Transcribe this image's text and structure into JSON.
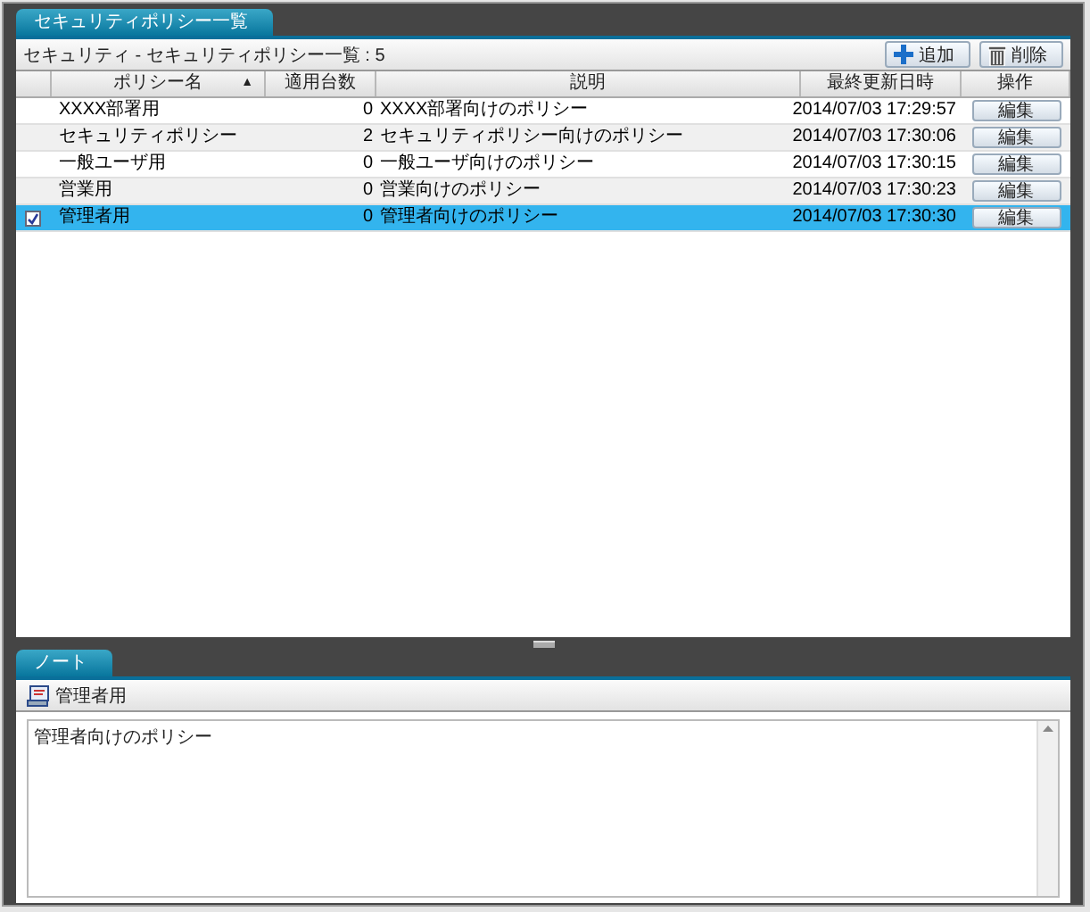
{
  "list_tab": {
    "label": "セキュリティポリシー一覧",
    "selected": true
  },
  "list_header": {
    "title": "セキュリティ - セキュリティポリシー一覧 : 5",
    "buttons": [
      {
        "kind": "add",
        "label": "追加"
      },
      {
        "kind": "delete",
        "label": "削除"
      }
    ]
  },
  "table": {
    "columns": [
      {
        "label": "ポリシー名",
        "sort": "▲"
      },
      {
        "label": "適用台数"
      },
      {
        "label": "説明"
      },
      {
        "label": "最終更新日時"
      },
      {
        "label": "操作"
      }
    ],
    "rows": [
      {
        "checked": false,
        "selected": false,
        "name": "XXXX部署用",
        "count": "0",
        "description": "XXXX部署向けのポリシー",
        "updated": "2014/07/03 17:29:57",
        "action": "編集"
      },
      {
        "checked": false,
        "selected": false,
        "name": "セキュリティポリシー",
        "count": "2",
        "description": "セキュリティポリシー向けのポリシー",
        "updated": "2014/07/03 17:30:06",
        "action": "編集"
      },
      {
        "checked": false,
        "selected": false,
        "name": "一般ユーザ用",
        "count": "0",
        "description": "一般ユーザ向けのポリシー",
        "updated": "2014/07/03 17:30:15",
        "action": "編集"
      },
      {
        "checked": false,
        "selected": false,
        "name": "営業用",
        "count": "0",
        "description": "営業向けのポリシー",
        "updated": "2014/07/03 17:30:23",
        "action": "編集"
      },
      {
        "checked": true,
        "selected": true,
        "name": "管理者用",
        "count": "0",
        "description": "管理者向けのポリシー",
        "updated": "2014/07/03 17:30:30",
        "action": "編集"
      }
    ]
  },
  "note_tab": {
    "label": "ノート",
    "selected": true
  },
  "note": {
    "title": "管理者用",
    "text": "管理者向けのポリシー"
  }
}
